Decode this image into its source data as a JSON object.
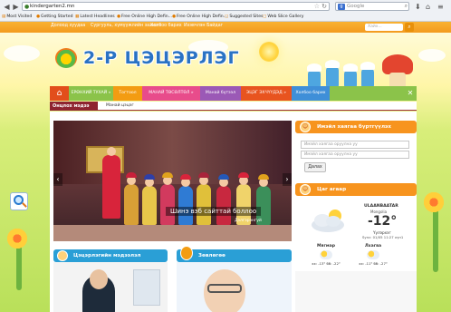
{
  "browser": {
    "url": "kindergarten2.mn",
    "search_placeholder": "Google",
    "bookmarks": [
      "Most Visited",
      "Getting Started",
      "Latest Headlines",
      "Free Online High Defin...",
      "Free Online High Defin...",
      "Suggested Sites",
      "Web Slice Gallery"
    ]
  },
  "top_bar": {
    "links": [
      "Долоод хуудаа",
      "Сургууль, хүмүүжлийн захиа »",
      "Холбоо барих",
      "Ихэвчлэн Байдаг"
    ],
    "search_placeholder": "Хайх..."
  },
  "site": {
    "title": "2-Р ЦЭЦЭРЛЭГ"
  },
  "menu": {
    "items": [
      {
        "label": "ЕРӨНХИЙ ТУХАЙ »",
        "color": "#8bc34a"
      },
      {
        "label": "Тогтоол",
        "color": "#f39c12"
      },
      {
        "label": "МАНАЙ ТӨСӨЛТӨЛ »",
        "color": "#e84c8b"
      },
      {
        "label": "Манай бүтээл",
        "color": "#9b59b6"
      },
      {
        "label": "ЭЦЭГ ЭХЧҮҮДЭД »",
        "color": "#e8541f"
      },
      {
        "label": "Холбоо барих",
        "color": "#3f8fd8"
      }
    ]
  },
  "subbar": {
    "tab_label": "Онцлох мэдээ",
    "link_label": "Манай цэцэг"
  },
  "slider": {
    "caption": "Шинэ вэб сайттай боллоо",
    "more": "Дэлгэрэнгүй"
  },
  "login_widget": {
    "title": "Имэйл хаягаа бүртгүүлэх",
    "input1_placeholder": "Имэйл хаягаа оруулна уу",
    "input2_placeholder": "Имэйл хаягаа оруулна уу",
    "button_label": "Далах"
  },
  "weather_widget": {
    "title": "Цаг агаар",
    "city": "ULAANBAATAR",
    "country": "Mongolia",
    "temperature": "-12°",
    "condition": "Үүлэрхэг",
    "updated": "Sync: 01/05 11:27 хүн1",
    "days": [
      {
        "name": "Мягмар",
        "temps": "хх: -13° бб: -22°"
      },
      {
        "name": "Лхагва",
        "temps": "хх: -11° бб: -27°"
      }
    ]
  },
  "boxes": {
    "left_title": "Цэцэрлэгийн мэдээлэл",
    "right_title": "Зөвлөгөө"
  },
  "colors": {
    "accent_orange": "#f7941e",
    "menu_green": "#8bc34a",
    "tab_maroon": "#8e2430",
    "box_blue": "#2a9fd6"
  }
}
